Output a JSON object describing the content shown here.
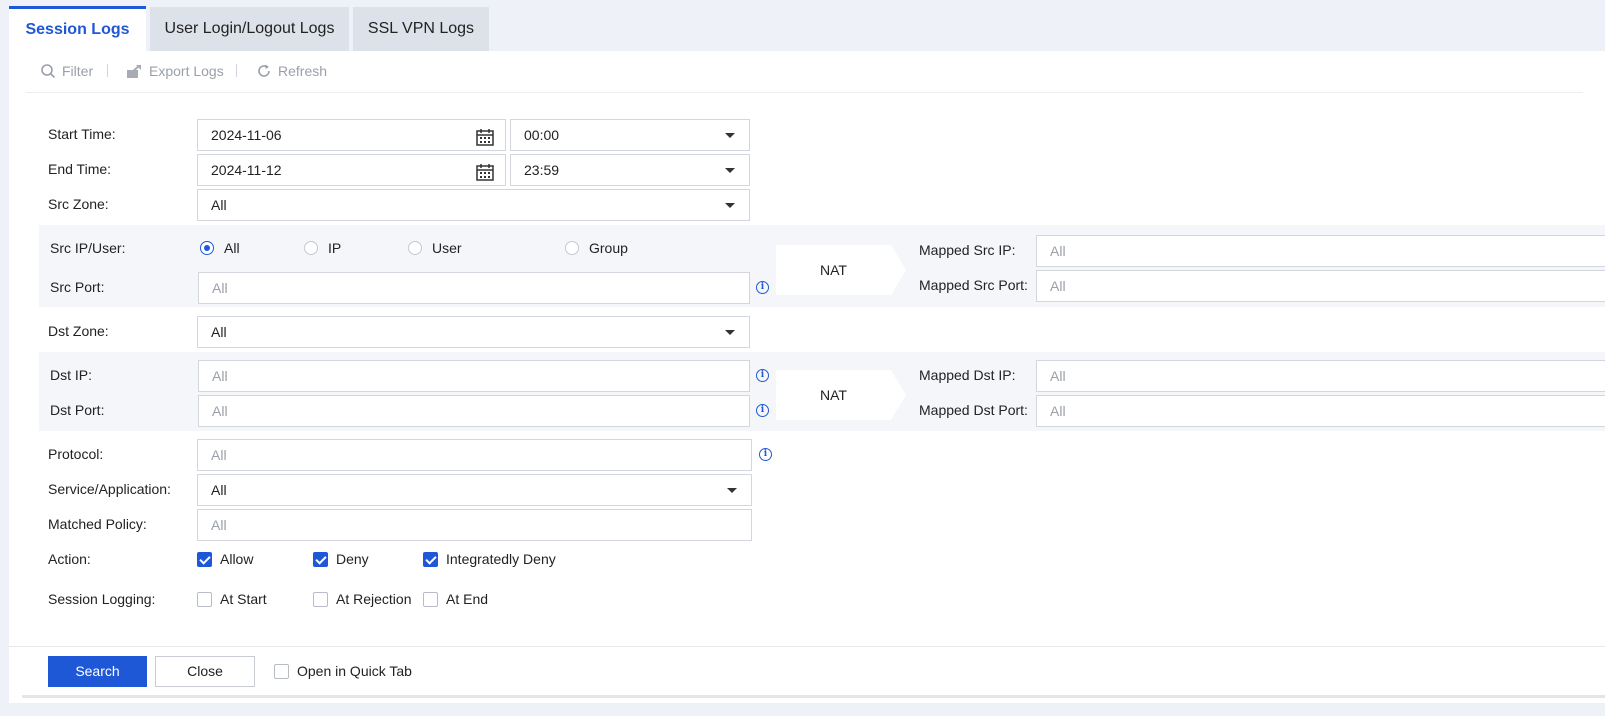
{
  "tabs": [
    {
      "label": "Session Logs",
      "active": true
    },
    {
      "label": "User Login/Logout Logs",
      "active": false
    },
    {
      "label": "SSL VPN Logs",
      "active": false
    }
  ],
  "toolbar": {
    "filter": "Filter",
    "export": "Export Logs",
    "refresh": "Refresh"
  },
  "form": {
    "start_time": {
      "label": "Start Time:",
      "date": "2024-11-06",
      "time": "00:00"
    },
    "end_time": {
      "label": "End Time:",
      "date": "2024-11-12",
      "time": "23:59"
    },
    "src_zone": {
      "label": "Src Zone:",
      "value": "All"
    },
    "src_ip_user": {
      "label": "Src IP/User:",
      "options": [
        "All",
        "IP",
        "User",
        "Group"
      ],
      "selected": "All"
    },
    "src_port": {
      "label": "Src Port:",
      "placeholder": "All"
    },
    "nat_src": "NAT",
    "mapped_src_ip": {
      "label": "Mapped Src IP:",
      "placeholder": "All"
    },
    "mapped_src_port": {
      "label": "Mapped Src Port:",
      "placeholder": "All"
    },
    "dst_zone": {
      "label": "Dst Zone:",
      "value": "All"
    },
    "dst_ip": {
      "label": "Dst IP:",
      "placeholder": "All"
    },
    "dst_port": {
      "label": "Dst Port:",
      "placeholder": "All"
    },
    "nat_dst": "NAT",
    "mapped_dst_ip": {
      "label": "Mapped Dst IP:",
      "placeholder": "All"
    },
    "mapped_dst_port": {
      "label": "Mapped Dst Port:",
      "placeholder": "All"
    },
    "protocol": {
      "label": "Protocol:",
      "placeholder": "All"
    },
    "service_app": {
      "label": "Service/Application:",
      "value": "All"
    },
    "matched_policy": {
      "label": "Matched Policy:",
      "placeholder": "All"
    },
    "action": {
      "label": "Action:",
      "options": [
        {
          "label": "Allow",
          "checked": true
        },
        {
          "label": "Deny",
          "checked": true
        },
        {
          "label": "Integratedly Deny",
          "checked": true
        }
      ]
    },
    "session_logging": {
      "label": "Session Logging:",
      "options": [
        {
          "label": "At Start",
          "checked": false
        },
        {
          "label": "At Rejection",
          "checked": false
        },
        {
          "label": "At End",
          "checked": false
        }
      ]
    }
  },
  "footer": {
    "search": "Search",
    "close": "Close",
    "quick_tab": {
      "label": "Open in Quick Tab",
      "checked": false
    }
  },
  "colors": {
    "accent": "#1f58d6",
    "tab_inactive": "#dde1ea",
    "band": "#f4f6fa"
  }
}
